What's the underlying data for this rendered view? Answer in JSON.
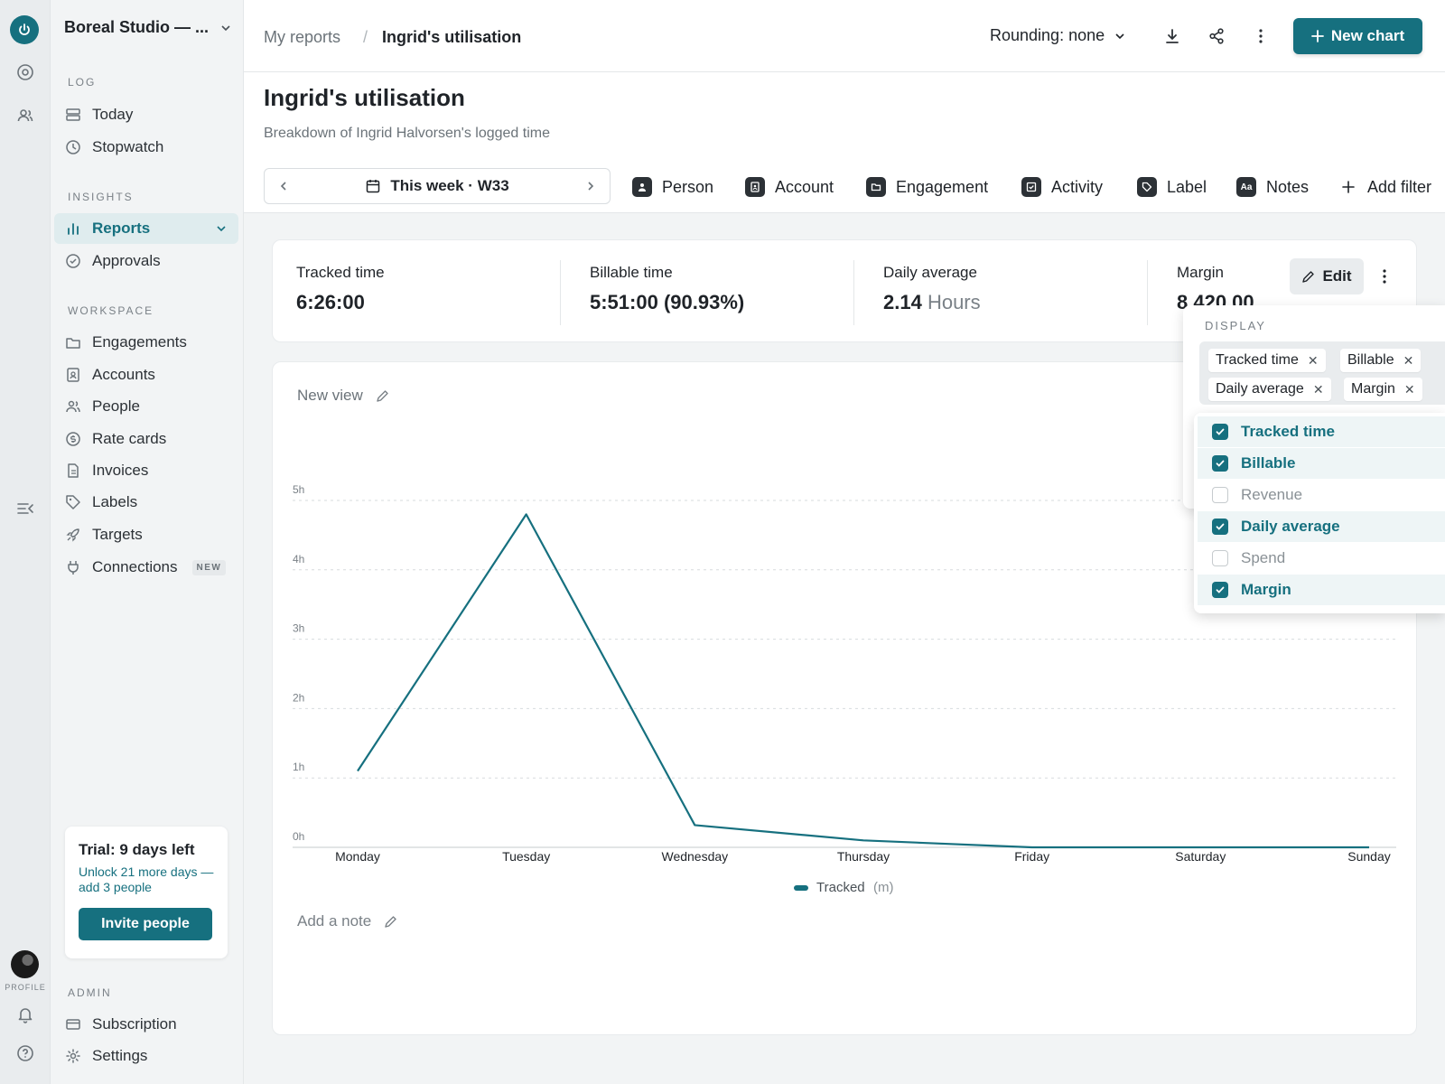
{
  "workspace": {
    "name": "Boreal Studio — ..."
  },
  "rail": {
    "profile_label": "PROFILE"
  },
  "sidebar": {
    "sections": {
      "log": "LOG",
      "insights": "INSIGHTS",
      "workspace": "WORKSPACE",
      "admin": "ADMIN"
    },
    "log_items": [
      "Today",
      "Stopwatch"
    ],
    "insights_items": [
      "Reports",
      "Approvals"
    ],
    "workspace_items": [
      "Engagements",
      "Accounts",
      "People",
      "Rate cards",
      "Invoices",
      "Labels",
      "Targets",
      "Connections"
    ],
    "connections_badge": "NEW",
    "admin_items": [
      "Subscription",
      "Settings"
    ]
  },
  "trial": {
    "title": "Trial: 9 days left",
    "desc": "Unlock 21 more days — add 3 people",
    "button": "Invite people"
  },
  "header": {
    "crumb_root": "My reports",
    "crumb_sep": "/",
    "crumb_current": "Ingrid's utilisation",
    "rounding": "Rounding: none",
    "new_chart": "New chart"
  },
  "page": {
    "title": "Ingrid's utilisation",
    "subtitle": "Breakdown of Ingrid Halvorsen's logged time"
  },
  "week_picker": {
    "label": "This week · W33"
  },
  "filters": [
    "Person",
    "Account",
    "Engagement",
    "Activity",
    "Label",
    "Notes",
    "Add filter"
  ],
  "metrics": [
    {
      "label": "Tracked time",
      "value": "6:26:00",
      "unit": ""
    },
    {
      "label": "Billable time",
      "value": "5:51:00 (90.93%)",
      "unit": ""
    },
    {
      "label": "Daily average",
      "value": "2.14",
      "unit": "Hours"
    },
    {
      "label": "Margin",
      "value": "8 420.00",
      "unit": ""
    }
  ],
  "metric_edit": "Edit",
  "view": {
    "name": "New view",
    "note": "Add a note"
  },
  "display": {
    "label": "DISPLAY",
    "chips": [
      "Tracked time",
      "Billable",
      "Daily average",
      "Margin"
    ],
    "options": [
      {
        "label": "Tracked time",
        "checked": true
      },
      {
        "label": "Billable",
        "checked": true
      },
      {
        "label": "Revenue",
        "checked": false
      },
      {
        "label": "Daily average",
        "checked": true
      },
      {
        "label": "Spend",
        "checked": false
      },
      {
        "label": "Margin",
        "checked": true
      }
    ]
  },
  "chart_data": {
    "type": "line",
    "categories": [
      "Monday",
      "Tuesday",
      "Wednesday",
      "Thursday",
      "Friday",
      "Saturday",
      "Sunday"
    ],
    "y_ticks": [
      "0h",
      "1h",
      "2h",
      "3h",
      "4h",
      "5h"
    ],
    "ylim": [
      0,
      5
    ],
    "series": [
      {
        "name": "Tracked",
        "unit": "(m)",
        "color": "#16707f",
        "values": [
          1.1,
          4.8,
          0.32,
          0.1,
          0.0,
          0.0,
          0.0
        ]
      }
    ],
    "grid": true,
    "legend": "bottom-center"
  },
  "colors": {
    "accent": "#16707f"
  }
}
